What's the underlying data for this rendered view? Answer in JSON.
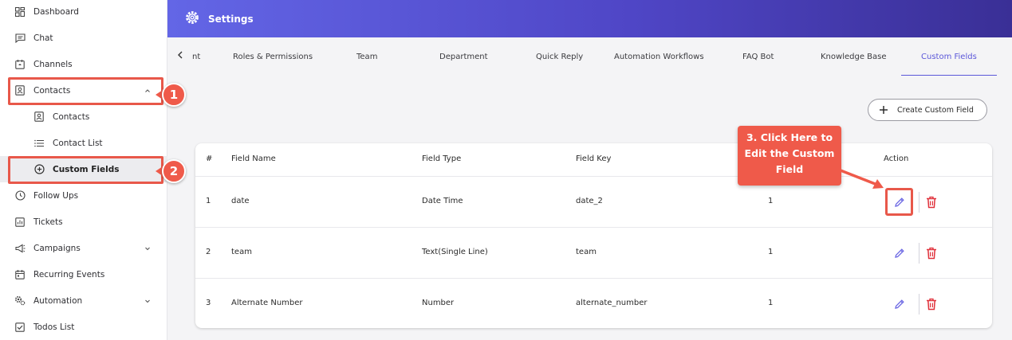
{
  "sidebar": {
    "items": [
      {
        "label": "Dashboard",
        "icon": "dashboard-icon"
      },
      {
        "label": "Chat",
        "icon": "chat-icon"
      },
      {
        "label": "Channels",
        "icon": "channels-icon"
      },
      {
        "label": "Contacts",
        "icon": "contacts-icon"
      },
      {
        "label": "Contacts",
        "icon": "contacts-icon"
      },
      {
        "label": "Contact List",
        "icon": "list-icon"
      },
      {
        "label": "Custom Fields",
        "icon": "add-circle-icon"
      },
      {
        "label": "Follow Ups",
        "icon": "clock-icon"
      },
      {
        "label": "Tickets",
        "icon": "tickets-icon"
      },
      {
        "label": "Campaigns",
        "icon": "megaphone-icon"
      },
      {
        "label": "Recurring Events",
        "icon": "calendar-icon"
      },
      {
        "label": "Automation",
        "icon": "automation-gear-icon"
      },
      {
        "label": "Todos List",
        "icon": "checkbox-icon"
      }
    ]
  },
  "callouts": {
    "one": "1",
    "two": "2"
  },
  "header": {
    "title": "Settings"
  },
  "tabs": [
    {
      "label": "nt"
    },
    {
      "label": "Roles & Permissions"
    },
    {
      "label": "Team"
    },
    {
      "label": "Department"
    },
    {
      "label": "Quick Reply"
    },
    {
      "label": "Automation Workflows"
    },
    {
      "label": "FAQ Bot"
    },
    {
      "label": "Knowledge Base"
    },
    {
      "label": "Custom Fields"
    }
  ],
  "create_button": {
    "label": "Create Custom Field"
  },
  "table": {
    "headers": [
      "#",
      "Field Name",
      "Field Type",
      "Field Key",
      "Action"
    ],
    "rows": [
      {
        "num": "1",
        "name": "date",
        "type": "Date Time",
        "key": "date_2",
        "count": "1"
      },
      {
        "num": "2",
        "name": "team",
        "type": "Text(Single Line)",
        "key": "team",
        "count": "1"
      },
      {
        "num": "3",
        "name": "Alternate Number",
        "type": "Number",
        "key": "alternate_number",
        "count": "1"
      }
    ]
  },
  "tooltip": {
    "line1": "3. Click Here to",
    "line2": "Edit the Custom",
    "line3": "Field"
  },
  "colors": {
    "accent": "#5b57d9",
    "annotation": "#ef5a4a",
    "delete": "#e0313b",
    "edit": "#6a66e3"
  }
}
